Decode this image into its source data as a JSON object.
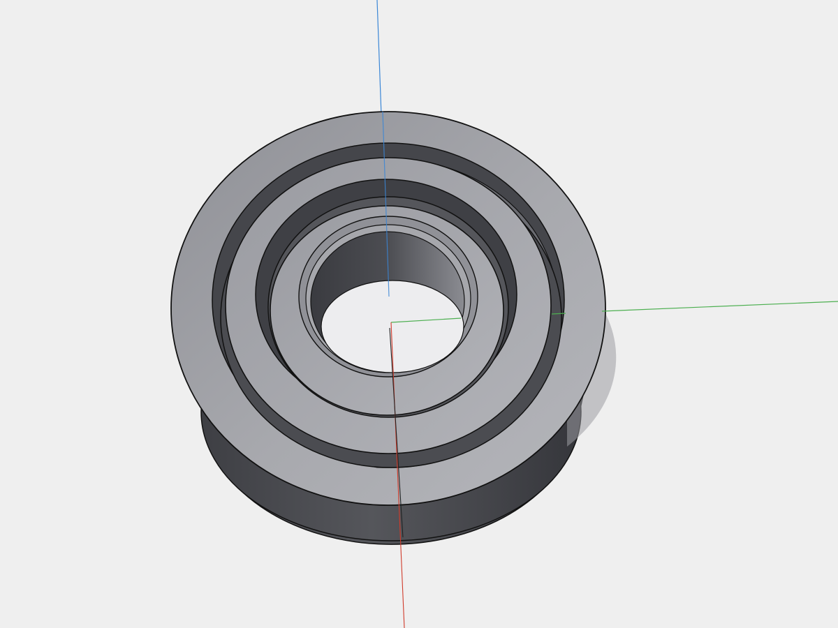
{
  "viewport": {
    "background_color": "#efefef",
    "model": "ball-bearing",
    "view": "isometric-perspective",
    "axes": {
      "x_axis_color": "#d03a2a",
      "y_axis_color": "#4caf50",
      "z_axis_color": "#3a86d6"
    },
    "colors": {
      "face_light": "#a4a5aa",
      "face_mid": "#8e8f95",
      "side_dark": "#4a4b50",
      "side_darker": "#3c3d42",
      "edge": "#111111",
      "hole_highlight": "#e9e9ec",
      "ball_highlight": "#d6d6da"
    }
  }
}
